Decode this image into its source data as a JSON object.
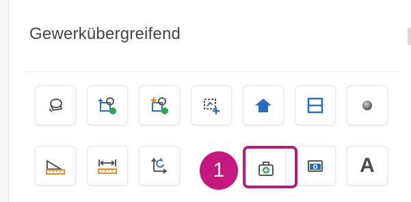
{
  "section": {
    "title": "Gewerkübergreifend"
  },
  "callout": {
    "step": "1"
  },
  "text_tool": {
    "glyph": "A"
  },
  "colors": {
    "accent_blue": "#2a6ebb",
    "accent_green": "#2ea44f",
    "accent_orange": "#e38b2c",
    "highlight_magenta": "#b01d7a"
  },
  "toolbar": {
    "row1": [
      {
        "icon": "eraser-stamp-icon"
      },
      {
        "icon": "add-object-icon"
      },
      {
        "icon": "add-object-star-icon"
      },
      {
        "icon": "select-area-plus-icon"
      },
      {
        "icon": "house-icon"
      },
      {
        "icon": "split-horizontal-icon"
      },
      {
        "icon": "sphere-icon"
      }
    ],
    "row2": [
      {
        "icon": "area-measure-icon"
      },
      {
        "icon": "length-measure-icon"
      },
      {
        "icon": "rotate-arrows-icon"
      },
      {
        "icon": "medical-kit-icon"
      },
      {
        "icon": "camera-icon"
      },
      {
        "icon": "text-icon"
      }
    ]
  }
}
